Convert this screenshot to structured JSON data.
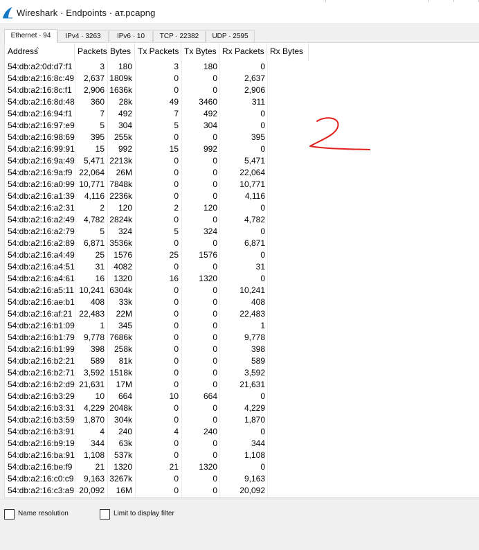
{
  "window": {
    "title": "Wireshark · Endpoints · ат.pcapng"
  },
  "tabs": [
    {
      "label": "Ethernet · 94",
      "active": true
    },
    {
      "label": "IPv4 · 3263"
    },
    {
      "label": "IPv6 · 10"
    },
    {
      "label": "TCP · 22382"
    },
    {
      "label": "UDP · 2595"
    }
  ],
  "table": {
    "columns": [
      "Address",
      "Packets",
      "Bytes",
      "Tx Packets",
      "Tx Bytes",
      "Rx Packets",
      "Rx Bytes"
    ],
    "sorted_column": "Address",
    "rows": [
      [
        "54:db:a2:0d:d7:f1",
        "3",
        "180",
        "3",
        "180",
        "0"
      ],
      [
        "54:db:a2:16:8c:49",
        "2,637",
        "1809k",
        "0",
        "0",
        "2,637"
      ],
      [
        "54:db:a2:16:8c:f1",
        "2,906",
        "1636k",
        "0",
        "0",
        "2,906"
      ],
      [
        "54:db:a2:16:8d:48",
        "360",
        "28k",
        "49",
        "3460",
        "311"
      ],
      [
        "54:db:a2:16:94:f1",
        "7",
        "492",
        "7",
        "492",
        "0"
      ],
      [
        "54:db:a2:16:97:e9",
        "5",
        "304",
        "5",
        "304",
        "0"
      ],
      [
        "54:db:a2:16:98:69",
        "395",
        "255k",
        "0",
        "0",
        "395"
      ],
      [
        "54:db:a2:16:99:91",
        "15",
        "992",
        "15",
        "992",
        "0"
      ],
      [
        "54:db:a2:16:9a:49",
        "5,471",
        "2213k",
        "0",
        "0",
        "5,471"
      ],
      [
        "54:db:a2:16:9a:f9",
        "22,064",
        "26M",
        "0",
        "0",
        "22,064"
      ],
      [
        "54:db:a2:16:a0:99",
        "10,771",
        "7848k",
        "0",
        "0",
        "10,771"
      ],
      [
        "54:db:a2:16:a1:39",
        "4,116",
        "2236k",
        "0",
        "0",
        "4,116"
      ],
      [
        "54:db:a2:16:a2:31",
        "2",
        "120",
        "2",
        "120",
        "0"
      ],
      [
        "54:db:a2:16:a2:49",
        "4,782",
        "2824k",
        "0",
        "0",
        "4,782"
      ],
      [
        "54:db:a2:16:a2:79",
        "5",
        "324",
        "5",
        "324",
        "0"
      ],
      [
        "54:db:a2:16:a2:89",
        "6,871",
        "3536k",
        "0",
        "0",
        "6,871"
      ],
      [
        "54:db:a2:16:a4:49",
        "25",
        "1576",
        "25",
        "1576",
        "0"
      ],
      [
        "54:db:a2:16:a4:51",
        "31",
        "4082",
        "0",
        "0",
        "31"
      ],
      [
        "54:db:a2:16:a4:61",
        "16",
        "1320",
        "16",
        "1320",
        "0"
      ],
      [
        "54:db:a2:16:a5:11",
        "10,241",
        "6304k",
        "0",
        "0",
        "10,241"
      ],
      [
        "54:db:a2:16:ae:b1",
        "408",
        "33k",
        "0",
        "0",
        "408"
      ],
      [
        "54:db:a2:16:af:21",
        "22,483",
        "22M",
        "0",
        "0",
        "22,483"
      ],
      [
        "54:db:a2:16:b1:09",
        "1",
        "345",
        "0",
        "0",
        "1"
      ],
      [
        "54:db:a2:16:b1:79",
        "9,778",
        "7686k",
        "0",
        "0",
        "9,778"
      ],
      [
        "54:db:a2:16:b1:99",
        "398",
        "258k",
        "0",
        "0",
        "398"
      ],
      [
        "54:db:a2:16:b2:21",
        "589",
        "81k",
        "0",
        "0",
        "589"
      ],
      [
        "54:db:a2:16:b2:71",
        "3,592",
        "1518k",
        "0",
        "0",
        "3,592"
      ],
      [
        "54:db:a2:16:b2:d9",
        "21,631",
        "17M",
        "0",
        "0",
        "21,631"
      ],
      [
        "54:db:a2:16:b3:29",
        "10",
        "664",
        "10",
        "664",
        "0"
      ],
      [
        "54:db:a2:16:b3:31",
        "4,229",
        "2048k",
        "0",
        "0",
        "4,229"
      ],
      [
        "54:db:a2:16:b3:59",
        "1,870",
        "304k",
        "0",
        "0",
        "1,870"
      ],
      [
        "54:db:a2:16:b3:91",
        "4",
        "240",
        "4",
        "240",
        "0"
      ],
      [
        "54:db:a2:16:b9:19",
        "344",
        "63k",
        "0",
        "0",
        "344"
      ],
      [
        "54:db:a2:16:ba:91",
        "1,108",
        "537k",
        "0",
        "0",
        "1,108"
      ],
      [
        "54:db:a2:16:be:f9",
        "21",
        "1320",
        "21",
        "1320",
        "0"
      ],
      [
        "54:db:a2:16:c0:c9",
        "9,163",
        "3267k",
        "0",
        "0",
        "9,163"
      ],
      [
        "54:db:a2:16:c3:a9",
        "20,092",
        "16M",
        "0",
        "0",
        "20,092"
      ]
    ]
  },
  "footer": {
    "name_resolution_label": "Name resolution",
    "name_resolution_checked": false,
    "limit_filter_label": "Limit to display filter",
    "limit_filter_checked": false
  },
  "annotation": {
    "text": "2",
    "color": "#e0201c"
  },
  "colors": {
    "window_bg": "#f0f0f0",
    "panel_bg": "#ffffff",
    "app_icon": "#1679c5"
  }
}
